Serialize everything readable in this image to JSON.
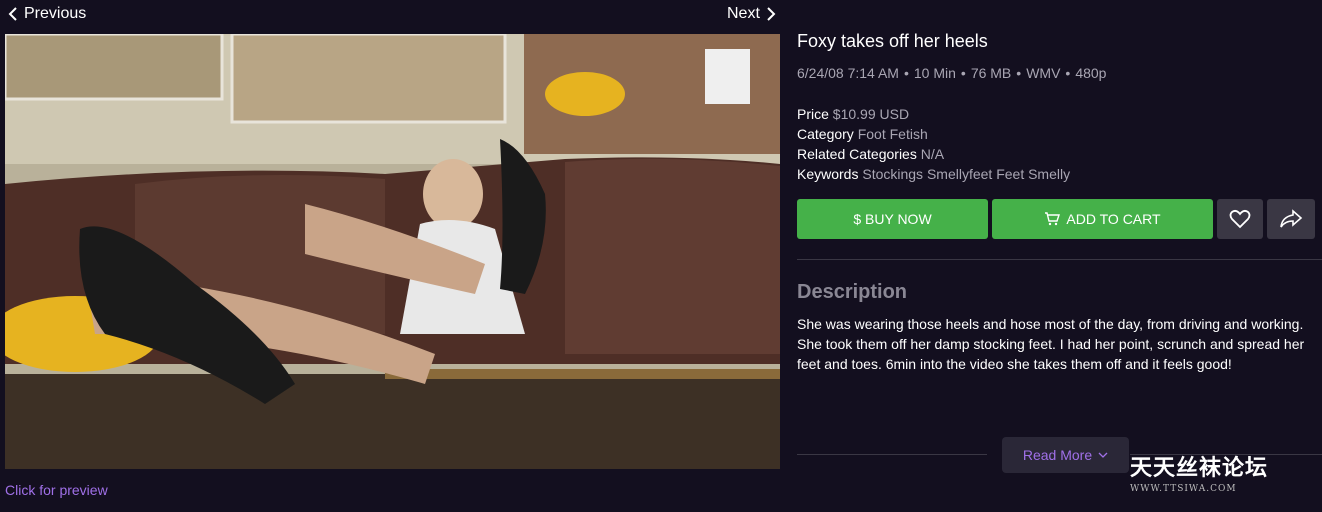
{
  "nav": {
    "previous_label": "Previous",
    "next_label": "Next"
  },
  "preview": {
    "link_label": "Click for preview"
  },
  "product": {
    "title": "Foxy takes off her heels",
    "meta": {
      "date": "6/24/08 7:14 AM",
      "duration": "10 Min",
      "size": "76 MB",
      "format": "WMV",
      "resolution": "480p",
      "separator": "•"
    },
    "price_label": "Price",
    "price_value": "$10.99 USD",
    "category_label": "Category",
    "category_value": "Foot Fetish",
    "related_label": "Related Categories",
    "related_value": "N/A",
    "keywords_label": "Keywords",
    "keywords_value": "Stockings Smellyfeet Feet Smelly"
  },
  "actions": {
    "buy_label": "$ BUY NOW",
    "cart_label": "ADD TO CART",
    "fav_icon": "heart-outline",
    "share_icon": "share-arrow",
    "accent_green": "#45b149"
  },
  "description": {
    "heading": "Description",
    "text": "She was wearing those heels and hose most of the day, from driving and working. She took them off her damp stocking feet. I had her point, scrunch and spread her feet and toes. 6min into the video she takes them off and it feels good!",
    "read_more_label": "Read More"
  },
  "watermark": {
    "text": "天天丝袜论坛",
    "url": "WWW.TTSIWA.COM"
  },
  "colors": {
    "background": "#130f1f",
    "link": "#a070e8",
    "muted": "#a9a6b3"
  }
}
